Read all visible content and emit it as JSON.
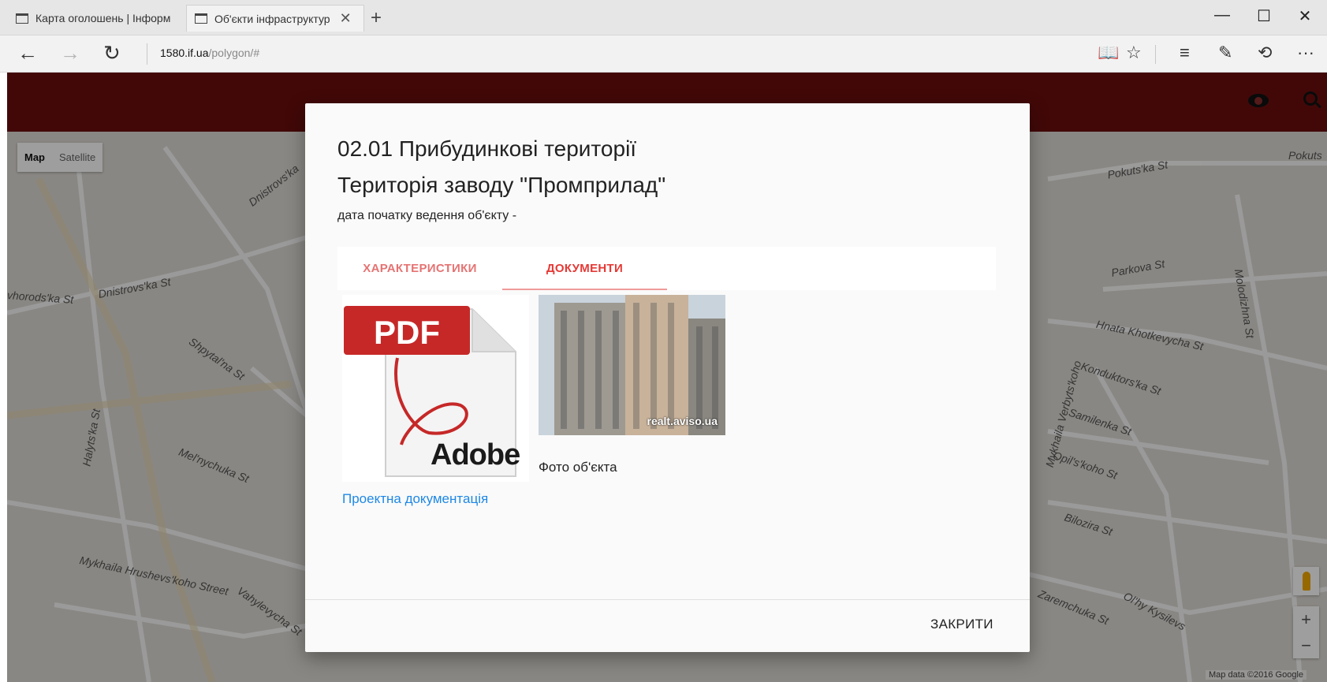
{
  "browser": {
    "tabs": [
      {
        "label": "Карта оголошень | Інформ"
      },
      {
        "label": "Об'єкти інфраструктур"
      }
    ],
    "new_tab_glyph": "+",
    "address": {
      "domain": "1580.if.ua",
      "path": "/polygon/#"
    },
    "nav": {
      "back": "←",
      "forward": "→",
      "refresh": "↻"
    },
    "window_controls": {
      "minimize": "—",
      "maximize": "☐",
      "close": "✕"
    },
    "tools": {
      "reading": "📖",
      "favorite": "☆",
      "hub": "≡",
      "note": "✎",
      "share": "⟲",
      "more": "···"
    }
  },
  "map": {
    "type_control": {
      "map": "Map",
      "satellite": "Satellite"
    },
    "streets": [
      "Dnistrovs'ka",
      "Pokuts'ka St",
      "Pokuts",
      "Parkova St",
      "Molodizhna St",
      "Hnata Khotkevycha St",
      "Konduktors'ka St",
      "Samilenka St",
      "Opil's'koho St",
      "Bilozira St",
      "Zaremchuka St",
      "Ol'hy Kysilevs",
      "Shpytal'na St",
      "Halyts'ka St",
      "Mel'nychuka St",
      "Mykhaila Hrushevs'koho Street",
      "Vahylevycha St",
      "Dnistrovs'ka St",
      "vhorods'ka St",
      "Mykhaila Verbyts'koho"
    ],
    "zoom_in": "+",
    "zoom_out": "−",
    "credit": "Map data ©2016 Google"
  },
  "modal": {
    "title": "02.01 Прибудинкові території",
    "subtitle": "Територія заводу \"Промприлад\"",
    "date_label": "дата початку ведення об'єкту -",
    "tabs": [
      {
        "label": "ХАРАКТЕРИСТИКИ",
        "active": false
      },
      {
        "label": "ДОКУМЕНТИ",
        "active": true
      }
    ],
    "documents": [
      {
        "thumb_text": "PDF",
        "brand": "Adobe",
        "label": "Проектна документація"
      },
      {
        "watermark": "realt.aviso.ua",
        "label": "Фото об'єкта"
      }
    ],
    "close_label": "ЗАКРИТИ"
  },
  "colors": {
    "header": "#6b0e0e",
    "tab_text": "#e57373",
    "link": "#1e88e5"
  }
}
